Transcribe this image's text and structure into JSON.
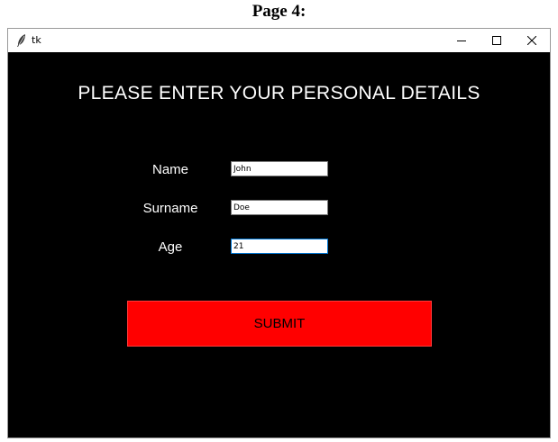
{
  "page": {
    "heading": "Page 4:"
  },
  "window": {
    "title": "tk",
    "app_icon": "feather-icon",
    "controls": {
      "minimize_icon": "minimize-icon",
      "maximize_icon": "maximize-icon",
      "close_icon": "close-icon"
    }
  },
  "form": {
    "heading": "PLEASE ENTER YOUR PERSONAL DETAILS",
    "fields": [
      {
        "label": "Name",
        "value": "John"
      },
      {
        "label": "Surname",
        "value": "Doe"
      },
      {
        "label": "Age",
        "value": "21"
      }
    ],
    "submit_label": "SUBMIT"
  },
  "colors": {
    "background": "#000000",
    "text": "#ffffff",
    "submit_bg": "#ff0000",
    "focus_border": "#0078d7"
  }
}
